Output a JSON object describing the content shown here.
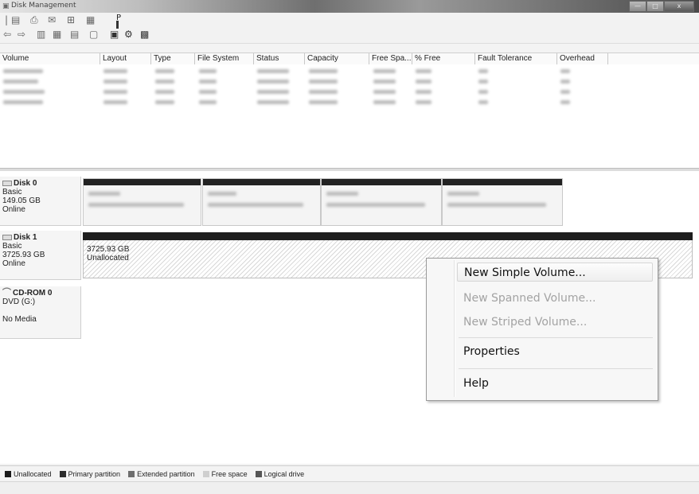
{
  "window": {
    "title": "Disk Management",
    "icon": "disk-management-icon"
  },
  "toolbar": {
    "icons": [
      "file-icon",
      "print-icon",
      "mail-icon",
      "printer-icon",
      "back-icon",
      "forward-icon",
      "grid-icon",
      "help-icon",
      "refresh-icon",
      "properties-icon",
      "settings-icon"
    ],
    "cursor_label": "P"
  },
  "columns": [
    "Volume",
    "Layout",
    "Type",
    "File System",
    "Status",
    "Capacity",
    "Free Spa...",
    "% Free",
    "Fault Tolerance",
    "Overhead"
  ],
  "disks": [
    {
      "name": "Disk 0",
      "type": "Basic",
      "size": "149.05 GB",
      "status": "Online"
    },
    {
      "name": "Disk 1",
      "type": "Basic",
      "size": "3725.93 GB",
      "status": "Online"
    },
    {
      "name": "CD-ROM 0",
      "type": "DVD (G:)",
      "size": "",
      "status": "No Media"
    }
  ],
  "disk1_unallocated": {
    "size": "3725.93 GB",
    "label": "Unallocated"
  },
  "context_menu": [
    {
      "label": "New Simple Volume...",
      "enabled": true
    },
    {
      "label": "New Spanned Volume...",
      "enabled": false
    },
    {
      "label": "New Striped Volume...",
      "enabled": false
    },
    {
      "label": "Properties",
      "enabled": true
    },
    {
      "label": "Help",
      "enabled": true
    }
  ],
  "legend": [
    {
      "label": "Unallocated",
      "color": "#1a1a1a"
    },
    {
      "label": "Primary partition",
      "color": "#2c2c2c"
    },
    {
      "label": "Extended partition",
      "color": "#6e6e6e"
    },
    {
      "label": "Free space",
      "color": "#cfcfcf"
    },
    {
      "label": "Logical drive",
      "color": "#555555"
    }
  ]
}
